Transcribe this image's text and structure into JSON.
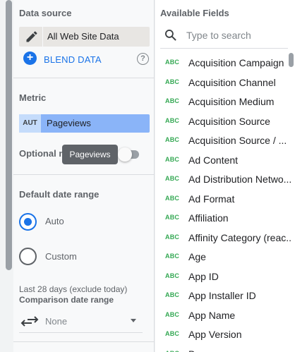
{
  "data_source": {
    "section_label": "Data source",
    "name": "All Web Site Data",
    "blend_label": "BLEND DATA",
    "help_glyph": "?"
  },
  "metric": {
    "section_label": "Metric",
    "aggregation": "AUT",
    "name": "Pageviews",
    "optional_label": "Optional m",
    "tooltip": "Pageviews"
  },
  "date_range": {
    "section_label": "Default date range",
    "options": [
      {
        "label": "Auto",
        "selected": true
      },
      {
        "label": "Custom",
        "selected": false
      }
    ],
    "note": "Last 28 days (exclude today)",
    "comparison_label": "Comparison date range",
    "comparison_value": "None"
  },
  "available_fields": {
    "section_label": "Available Fields",
    "search_placeholder": "Type to search",
    "type_badge": "ABC",
    "items": [
      "Acquisition Campaign",
      "Acquisition Channel",
      "Acquisition Medium",
      "Acquisition Source",
      "Acquisition Source / ...",
      "Ad Content",
      "Ad Distribution Netwo...",
      "Ad Format",
      "Affiliation",
      "Affinity Category (reac...",
      "Age",
      "App ID",
      "App Installer ID",
      "App Name",
      "App Version",
      "Browser"
    ]
  },
  "colors": {
    "accent": "#1a73e8",
    "metric_chip": "#8ab4f8",
    "type_badge": "#34a853"
  }
}
